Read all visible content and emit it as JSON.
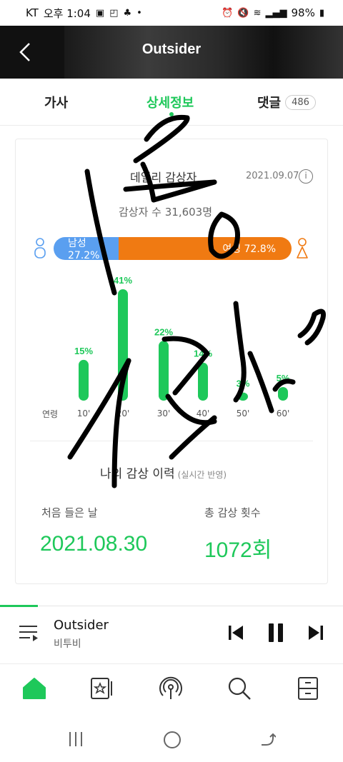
{
  "status_bar": {
    "carrier": "KT",
    "time": "오후 1:04",
    "battery": "98%"
  },
  "header": {
    "title": "Outsider"
  },
  "tabs": {
    "lyrics": "가사",
    "details": "상세정보",
    "comments": "댓글",
    "comment_count": "486"
  },
  "daily": {
    "title": "데일리 감상자",
    "date": "2021.09.07",
    "info_icon": "info-icon",
    "listeners": "감상자 수 31,603명"
  },
  "gender": {
    "male_label": "남성 27.2%",
    "female_label": "여성 72.8%",
    "male_share": 0.272,
    "male_color": "#5a9ff0",
    "female_color": "#f07a12"
  },
  "chart_data": {
    "type": "bar",
    "title": "",
    "xlabel": "연령",
    "ylabel": "",
    "categories": [
      "10'",
      "20'",
      "30'",
      "40'",
      "50'",
      "60'"
    ],
    "values": [
      15,
      41,
      22,
      14,
      3,
      5
    ],
    "value_labels": [
      "15%",
      "41%",
      "22%",
      "14%",
      "3%",
      "5%"
    ],
    "color": "#1ec85a",
    "ylim": [
      0,
      41
    ]
  },
  "history": {
    "title": "나의 감상 이력",
    "note": "(실시간 반영)",
    "first_listen_label": "처음 들은 날",
    "first_listen_value": "2021.08.30",
    "total_label": "총 감상 횟수",
    "total_value": "1072회"
  },
  "player": {
    "title": "Outsider",
    "artist": "비투비",
    "progress": 0.11
  },
  "bottom_nav": [
    "home-icon",
    "library-icon",
    "broadcast-icon",
    "search-icon",
    "storage-icon"
  ],
  "colors": {
    "accent": "#1ec85a"
  }
}
